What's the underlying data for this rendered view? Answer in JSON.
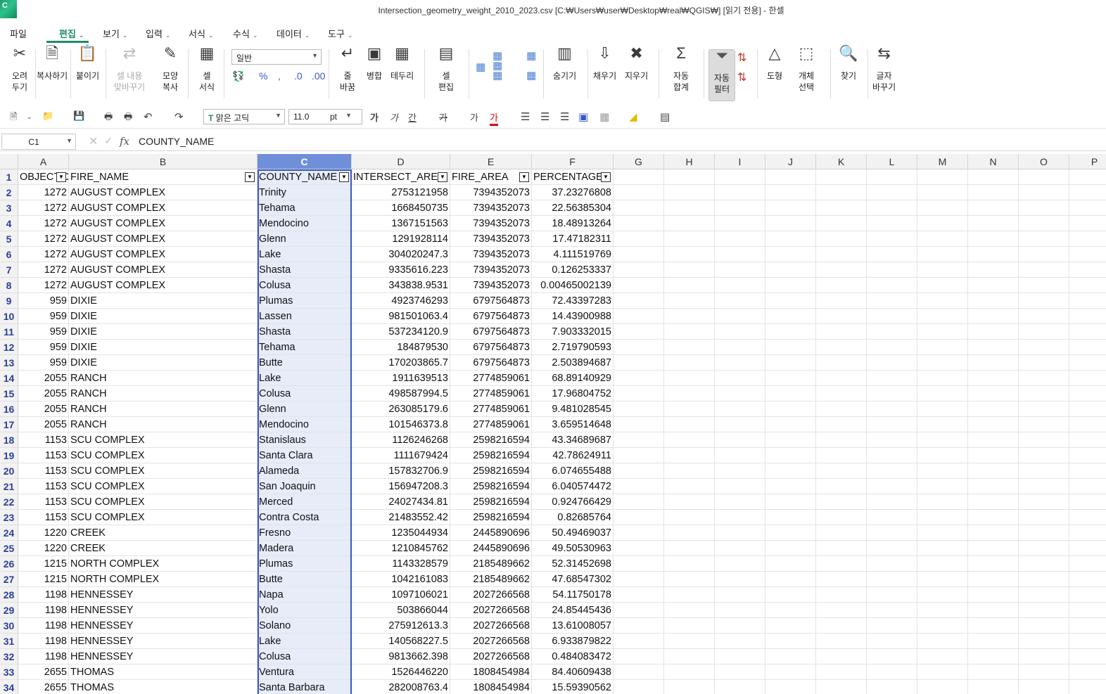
{
  "app": {
    "icon_letter": "C",
    "title": "Intersection_geometry_weight_2010_2023.csv [C:₩Users₩user₩Desktop₩real₩QGIS₩] [읽기 전용] - 한셀"
  },
  "menu": [
    "파일",
    "편집",
    "보기",
    "입력",
    "서식",
    "수식",
    "데이터",
    "도구"
  ],
  "ribbon": {
    "cut": "오려\n두기",
    "copy": "복사하기",
    "paste": "붙이기",
    "paste_content": "셀 내용\n맞바꾸기",
    "format_painter": "모양\n복사",
    "cell_format": "셀\n서식",
    "number_format": "일반",
    "wrap": "줄\n바꿈",
    "merge": "병합",
    "border": "테두리",
    "cell_edit": "셀\n편집",
    "hide": "숨기기",
    "fill": "채우기",
    "clear": "지우기",
    "autosum": "자동\n합계",
    "autofilter": "자동\n필터",
    "shape": "도형",
    "select_obj": "개체\n선택",
    "find": "찾기",
    "replace": "글자\n바꾸기"
  },
  "toolbar": {
    "font_name": "맑은 고딕",
    "font_size": "11.0",
    "font_unit": "pt"
  },
  "formula_bar": {
    "cell_ref": "C1",
    "content": "COUNTY_NAME"
  },
  "columns": [
    "A",
    "B",
    "C",
    "D",
    "E",
    "F",
    "G",
    "H",
    "I",
    "J",
    "K",
    "L",
    "M",
    "N",
    "O",
    "P"
  ],
  "selected_column": "C",
  "headers": [
    "OBJECTID",
    "FIRE_NAME",
    "COUNTY_NAME",
    "INTERSECT_AREA",
    "FIRE_AREA",
    "PERCENTAGE"
  ],
  "rows": [
    [
      "1272",
      "AUGUST COMPLEX",
      "Trinity",
      "2753121958",
      "7394352073",
      "37.23276808"
    ],
    [
      "1272",
      "AUGUST COMPLEX",
      "Tehama",
      "1668450735",
      "7394352073",
      "22.56385304"
    ],
    [
      "1272",
      "AUGUST COMPLEX",
      "Mendocino",
      "1367151563",
      "7394352073",
      "18.48913264"
    ],
    [
      "1272",
      "AUGUST COMPLEX",
      "Glenn",
      "1291928114",
      "7394352073",
      "17.47182311"
    ],
    [
      "1272",
      "AUGUST COMPLEX",
      "Lake",
      "304020247.3",
      "7394352073",
      "4.111519769"
    ],
    [
      "1272",
      "AUGUST COMPLEX",
      "Shasta",
      "9335616.223",
      "7394352073",
      "0.126253337"
    ],
    [
      "1272",
      "AUGUST COMPLEX",
      "Colusa",
      "343838.9531",
      "7394352073",
      "0.00465002139"
    ],
    [
      "959",
      "DIXIE",
      "Plumas",
      "4923746293",
      "6797564873",
      "72.43397283"
    ],
    [
      "959",
      "DIXIE",
      "Lassen",
      "981501063.4",
      "6797564873",
      "14.43900988"
    ],
    [
      "959",
      "DIXIE",
      "Shasta",
      "537234120.9",
      "6797564873",
      "7.903332015"
    ],
    [
      "959",
      "DIXIE",
      "Tehama",
      "184879530",
      "6797564873",
      "2.719790593"
    ],
    [
      "959",
      "DIXIE",
      "Butte",
      "170203865.7",
      "6797564873",
      "2.503894687"
    ],
    [
      "2055",
      "RANCH",
      "Lake",
      "1911639513",
      "2774859061",
      "68.89140929"
    ],
    [
      "2055",
      "RANCH",
      "Colusa",
      "498587994.5",
      "2774859061",
      "17.96804752"
    ],
    [
      "2055",
      "RANCH",
      "Glenn",
      "263085179.6",
      "2774859061",
      "9.481028545"
    ],
    [
      "2055",
      "RANCH",
      "Mendocino",
      "101546373.8",
      "2774859061",
      "3.659514648"
    ],
    [
      "1153",
      "SCU COMPLEX",
      "Stanislaus",
      "1126246268",
      "2598216594",
      "43.34689687"
    ],
    [
      "1153",
      "SCU COMPLEX",
      "Santa Clara",
      "1111679424",
      "2598216594",
      "42.78624911"
    ],
    [
      "1153",
      "SCU COMPLEX",
      "Alameda",
      "157832706.9",
      "2598216594",
      "6.074655488"
    ],
    [
      "1153",
      "SCU COMPLEX",
      "San Joaquin",
      "156947208.3",
      "2598216594",
      "6.040574472"
    ],
    [
      "1153",
      "SCU COMPLEX",
      "Merced",
      "24027434.81",
      "2598216594",
      "0.924766429"
    ],
    [
      "1153",
      "SCU COMPLEX",
      "Contra Costa",
      "21483552.42",
      "2598216594",
      "0.82685764"
    ],
    [
      "1220",
      "CREEK",
      "Fresno",
      "1235044934",
      "2445890696",
      "50.49469037"
    ],
    [
      "1220",
      "CREEK",
      "Madera",
      "1210845762",
      "2445890696",
      "49.50530963"
    ],
    [
      "1215",
      "NORTH COMPLEX",
      "Plumas",
      "1143328579",
      "2185489662",
      "52.31452698"
    ],
    [
      "1215",
      "NORTH COMPLEX",
      "Butte",
      "1042161083",
      "2185489662",
      "47.68547302"
    ],
    [
      "1198",
      "HENNESSEY",
      "Napa",
      "1097106021",
      "2027266568",
      "54.11750178"
    ],
    [
      "1198",
      "HENNESSEY",
      "Yolo",
      "503866044",
      "2027266568",
      "24.85445436"
    ],
    [
      "1198",
      "HENNESSEY",
      "Solano",
      "275912613.3",
      "2027266568",
      "13.61008057"
    ],
    [
      "1198",
      "HENNESSEY",
      "Lake",
      "140568227.5",
      "2027266568",
      "6.933879822"
    ],
    [
      "1198",
      "HENNESSEY",
      "Colusa",
      "9813662.398",
      "2027266568",
      "0.484083472"
    ],
    [
      "2655",
      "THOMAS",
      "Ventura",
      "1526446220",
      "1808454984",
      "84.40609438"
    ],
    [
      "2655",
      "THOMAS",
      "Santa Barbara",
      "282008763.4",
      "1808454984",
      "15.59390562"
    ]
  ]
}
